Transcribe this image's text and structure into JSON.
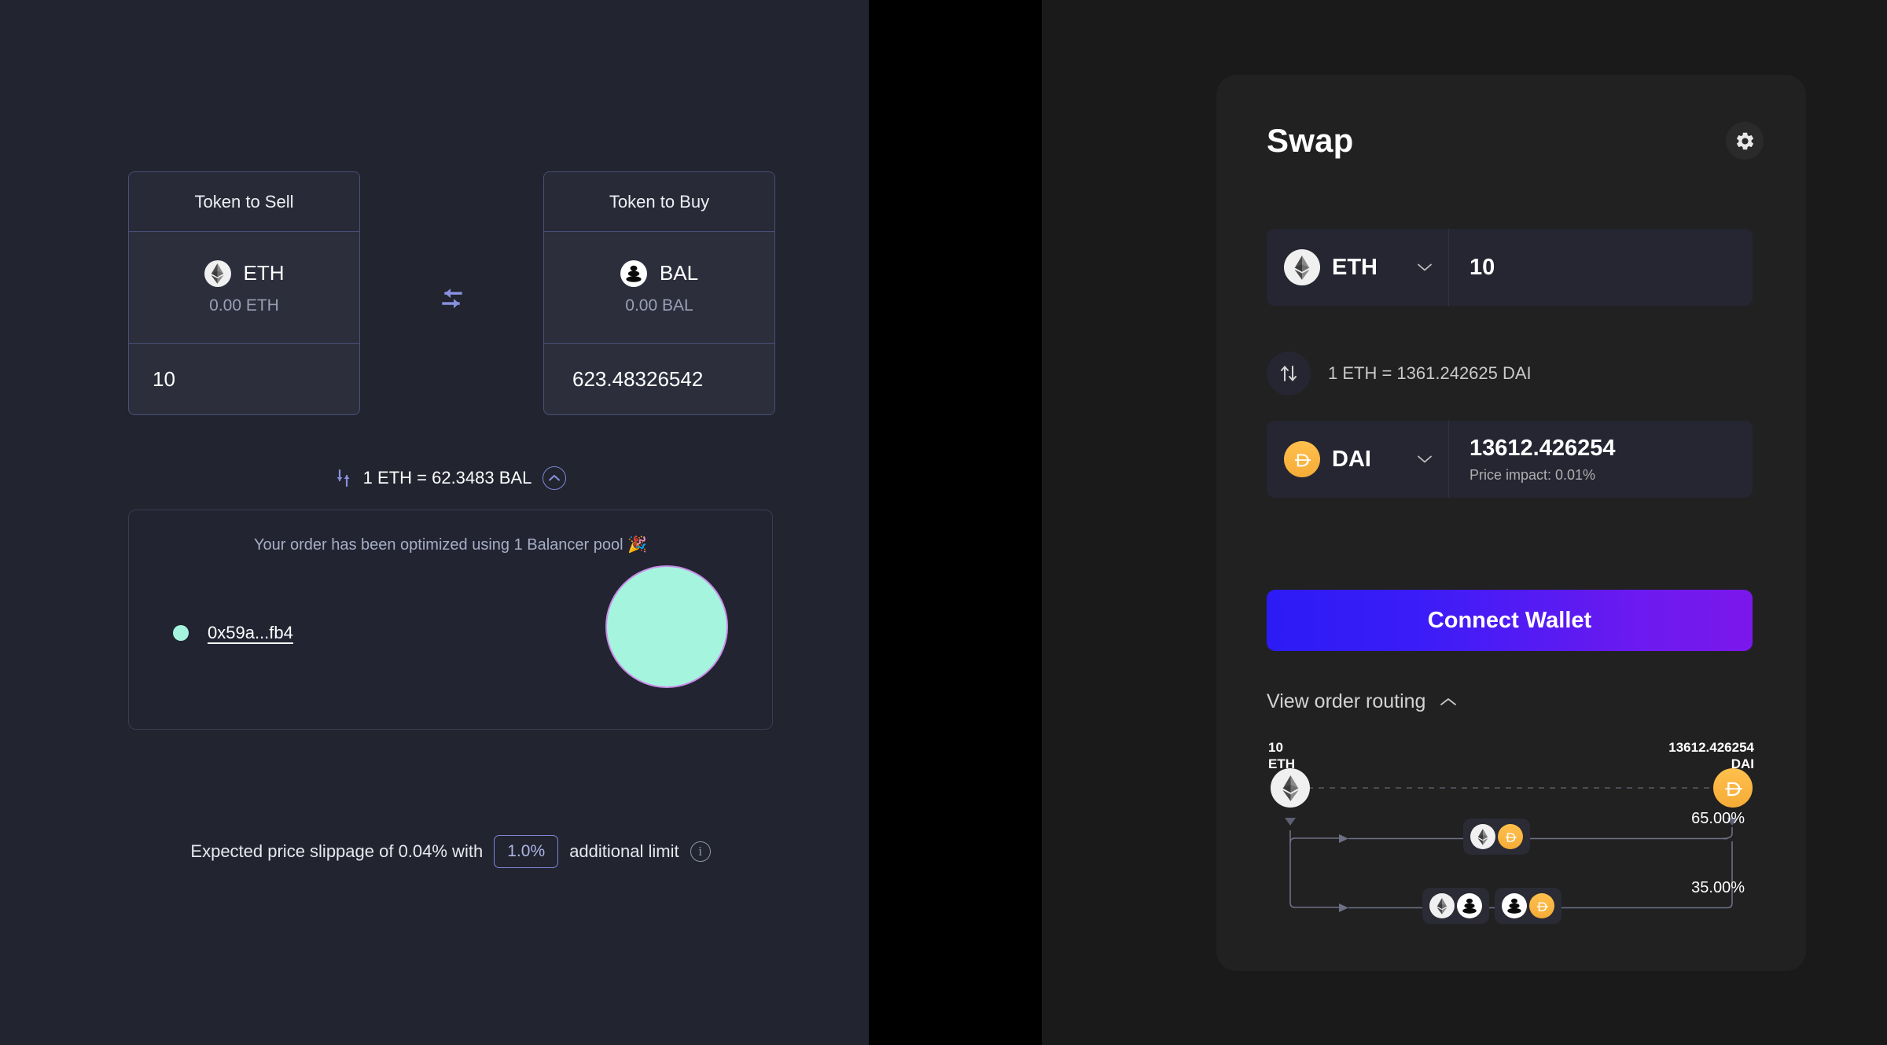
{
  "left_panel": {
    "sell_card": {
      "header": "Token to Sell",
      "token_symbol": "ETH",
      "token_icon": "eth-icon",
      "balance": "0.00 ETH",
      "amount": "10"
    },
    "buy_card": {
      "header": "Token to Buy",
      "token_symbol": "BAL",
      "token_icon": "bal-icon",
      "balance": "0.00 BAL",
      "amount": "623.48326542"
    },
    "swap_direction_icon": "swap-arrows-icon",
    "rate": {
      "icon": "updown-arrows-icon",
      "text": "1 ETH = 62.3483 BAL",
      "toggle_icon": "chevron-up-icon"
    },
    "optimization": {
      "title": "Your order has been optimized using 1 Balancer pool 🎉",
      "pools": [
        {
          "dot_color": "#A5F5DE",
          "label": "0x59a...fb4",
          "percent": "100%"
        }
      ],
      "pie_fill": "#A5F5DE",
      "pie_stroke": "#C98FE8"
    },
    "slippage": {
      "prefix": "Expected price slippage of 0.04% with",
      "value": "1.0%",
      "suffix": "additional limit",
      "info_icon": "info-icon"
    }
  },
  "swap_card": {
    "title": "Swap",
    "settings_icon": "gear-icon",
    "sell_field": {
      "token_symbol": "ETH",
      "token_icon": "eth-icon",
      "dropdown_icon": "chevron-down-icon",
      "amount": "10"
    },
    "rate_row": {
      "switch_icon": "up-down-arrows-icon",
      "text": "1 ETH = 1361.242625 DAI"
    },
    "buy_field": {
      "token_symbol": "DAI",
      "token_icon": "dai-icon",
      "dropdown_icon": "chevron-down-icon",
      "amount": "13612.426254",
      "price_impact": "Price impact: 0.01%"
    },
    "connect_button": "Connect Wallet",
    "view_order_routing": {
      "label": "View order routing",
      "toggle_icon": "chevron-up-icon"
    },
    "routing": {
      "source_amount": "10",
      "source_symbol": "ETH",
      "dest_amount": "13612.426254",
      "dest_symbol": "DAI",
      "source_icon": "eth-icon",
      "dest_icon": "dai-icon",
      "branches": [
        {
          "percent": "65.00%",
          "hops": [
            {
              "from_icon": "eth-icon",
              "to_icon": "dai-icon"
            }
          ]
        },
        {
          "percent": "35.00%",
          "hops": [
            {
              "from_icon": "eth-icon",
              "to_icon": "bal-icon"
            },
            {
              "from_icon": "bal-icon",
              "to_icon": "dai-icon"
            }
          ]
        }
      ]
    }
  },
  "colors": {
    "page_background": "#1A1A1A",
    "left_background": "#22242F",
    "gap_background": "#000000",
    "card_background": "#212121",
    "accent_purple": "#7D87D9",
    "connect_gradient_start": "#2C1BF5",
    "connect_gradient_end": "#7B18EC",
    "dai_yellow": "#F5AC37",
    "mint": "#A5F5DE"
  }
}
